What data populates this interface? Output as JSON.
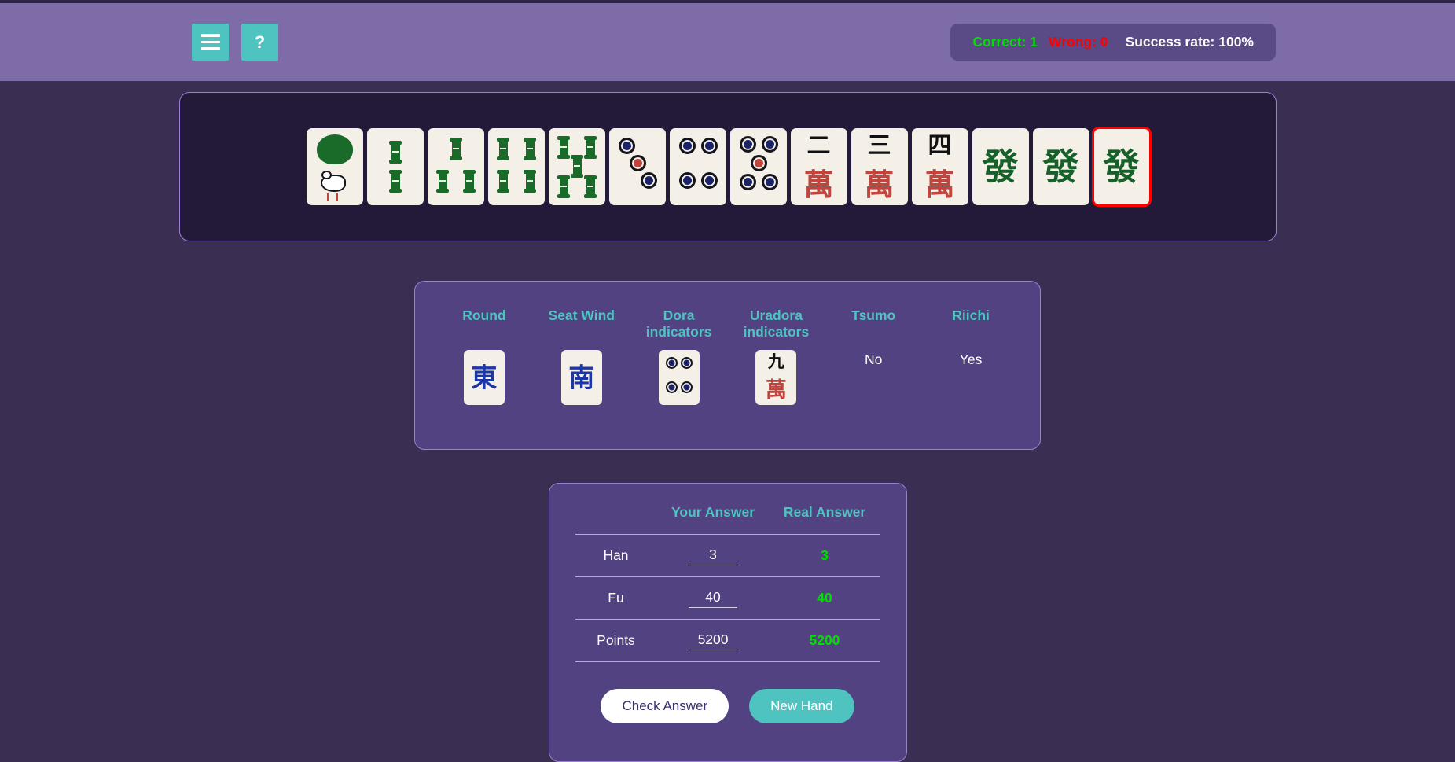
{
  "header": {
    "menu_icon": "hamburger-icon",
    "help_label": "?",
    "score": {
      "correct": "Correct: 1",
      "wrong": "Wrong: 0",
      "success_rate": "Success rate: 100%",
      "correct_color": "#00e000",
      "wrong_color": "#ff0000"
    }
  },
  "hand": {
    "tiles": [
      {
        "kind": "bamboo",
        "value": 1,
        "label": "1 Bamboo",
        "winning": false
      },
      {
        "kind": "bamboo",
        "value": 2,
        "label": "2 Bamboo",
        "winning": false
      },
      {
        "kind": "bamboo",
        "value": 3,
        "label": "3 Bamboo",
        "winning": false
      },
      {
        "kind": "bamboo",
        "value": 4,
        "label": "4 Bamboo",
        "winning": false
      },
      {
        "kind": "bamboo",
        "value": 5,
        "label": "5 Bamboo",
        "winning": false
      },
      {
        "kind": "circle",
        "value": 3,
        "label": "3 Circles",
        "winning": false
      },
      {
        "kind": "circle",
        "value": 4,
        "label": "4 Circles",
        "winning": false
      },
      {
        "kind": "circle",
        "value": 5,
        "label": "5 Circles red five",
        "red": true,
        "winning": false
      },
      {
        "kind": "character",
        "value": 2,
        "glyph": "二",
        "suit_glyph": "萬",
        "label": "2 Man",
        "winning": false
      },
      {
        "kind": "character",
        "value": 3,
        "glyph": "三",
        "suit_glyph": "萬",
        "label": "3 Man",
        "winning": false
      },
      {
        "kind": "character",
        "value": 4,
        "glyph": "四",
        "suit_glyph": "萬",
        "label": "4 Man",
        "winning": false
      },
      {
        "kind": "honor",
        "glyph": "發",
        "label": "Green Dragon",
        "winning": false
      },
      {
        "kind": "honor",
        "glyph": "發",
        "label": "Green Dragon",
        "winning": false
      },
      {
        "kind": "honor",
        "glyph": "發",
        "label": "Green Dragon",
        "winning": true
      }
    ]
  },
  "info": {
    "columns": [
      {
        "label": "Round",
        "type": "tile",
        "tile": {
          "kind": "honor",
          "glyph": "東",
          "label": "East"
        }
      },
      {
        "label": "Seat Wind",
        "type": "tile",
        "tile": {
          "kind": "honor",
          "glyph": "南",
          "label": "South"
        }
      },
      {
        "label": "Dora indicators",
        "type": "tiles",
        "tiles": [
          {
            "kind": "circle",
            "value": 4,
            "label": "4 Circles"
          }
        ]
      },
      {
        "label": "Uradora indicators",
        "type": "tiles",
        "tiles": [
          {
            "kind": "character",
            "glyph": "九",
            "suit_glyph": "萬",
            "label": "9 Man"
          }
        ]
      },
      {
        "label": "Tsumo",
        "type": "text",
        "value": "No"
      },
      {
        "label": "Riichi",
        "type": "text",
        "value": "Yes"
      }
    ]
  },
  "answer": {
    "col_your": "Your Answer",
    "col_real": "Real Answer",
    "rows": [
      {
        "label": "Han",
        "your": "3",
        "real": "3"
      },
      {
        "label": "Fu",
        "your": "40",
        "real": "40"
      },
      {
        "label": "Points",
        "your": "5200",
        "real": "5200"
      }
    ],
    "check_label": "Check Answer",
    "new_hand_label": "New Hand",
    "real_color": "#00e000"
  }
}
